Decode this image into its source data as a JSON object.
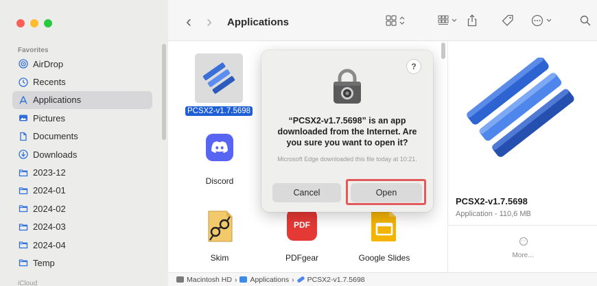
{
  "sidebar": {
    "section": "Favorites",
    "items": [
      {
        "label": "AirDrop",
        "icon": "airdrop-icon"
      },
      {
        "label": "Recents",
        "icon": "clock-icon"
      },
      {
        "label": "Applications",
        "icon": "applications-icon"
      },
      {
        "label": "Pictures",
        "icon": "pictures-icon"
      },
      {
        "label": "Documents",
        "icon": "document-icon"
      },
      {
        "label": "Downloads",
        "icon": "download-icon"
      },
      {
        "label": "2023-12",
        "icon": "folder-icon"
      },
      {
        "label": "2024-01",
        "icon": "folder-icon"
      },
      {
        "label": "2024-02",
        "icon": "folder-icon"
      },
      {
        "label": "2024-03",
        "icon": "folder-icon"
      },
      {
        "label": "2024-04",
        "icon": "folder-icon"
      },
      {
        "label": "Temp",
        "icon": "folder-icon"
      }
    ],
    "active_index": 2,
    "bottom_section": "iCloud"
  },
  "toolbar": {
    "back": "‹",
    "forward": "›",
    "title": "Applications"
  },
  "files": {
    "pcsx2": "PCSX2-v1.7.5698",
    "discord": "Discord",
    "skim": "Skim",
    "pdfgear": "PDFgear",
    "pdfgear_badge": "PDF",
    "google_slides": "Google Slides"
  },
  "dialog": {
    "help": "?",
    "title": "“PCSX2-v1.7.5698” is an app downloaded from the Internet. Are you sure you want to open it?",
    "subtitle": "Microsoft Edge downloaded this file today at 10:21.",
    "cancel": "Cancel",
    "open": "Open"
  },
  "preview": {
    "name": "PCSX2-v1.7.5698",
    "kind": "Application - 110,6 MB",
    "more": "More..."
  },
  "pathbar": {
    "items": [
      "Macintosh HD",
      "Applications",
      "PCSX2-v1.7.5698"
    ],
    "separator": "›"
  },
  "colors": {
    "close": "#ff5f57",
    "minimize": "#febc2e",
    "zoom": "#28c840",
    "selection": "#1f5fd6",
    "accent_highlight": "#e05a5a",
    "sidebar_icon": "#2f6fda"
  }
}
